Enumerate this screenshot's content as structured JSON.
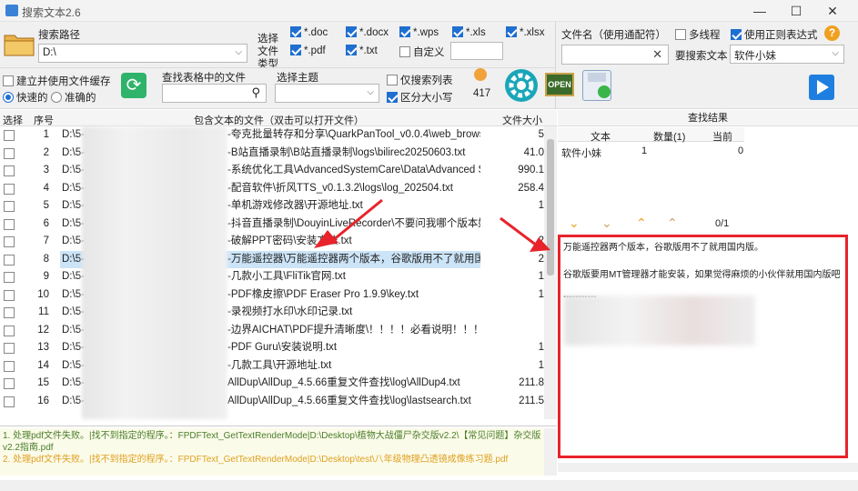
{
  "window": {
    "title": "搜索文本2.6"
  },
  "toolbar": {
    "search_path_label": "搜索路径",
    "search_path_value": "D:\\",
    "filetype_label": "选择文件类型",
    "types": [
      {
        "label": "*.doc",
        "checked": true
      },
      {
        "label": "*.docx",
        "checked": true
      },
      {
        "label": "*.wps",
        "checked": true
      },
      {
        "label": "*.xls",
        "checked": true
      },
      {
        "label": "*.xlsx",
        "checked": true
      },
      {
        "label": "*.pdf",
        "checked": true
      },
      {
        "label": "*.txt",
        "checked": true
      },
      {
        "label": "自定义",
        "checked": false
      }
    ],
    "filename_label": "文件名（使用通配符）",
    "multithread_label": "多线程",
    "multithread_checked": false,
    "regex_label": "使用正则表达式",
    "regex_checked": true,
    "search_text_label": "要搜索文本",
    "search_text_value": "软件小妹",
    "cache_label": "建立并使用文件缓存",
    "fast_label": "快速的",
    "accurate_label": "准确的",
    "table_search_label": "查找表格中的文件",
    "topic_label": "选择主题",
    "only_search_list_label": "仅搜索列表",
    "case_label": "区分大小写",
    "case_checked": true,
    "count_value": "417"
  },
  "grid": {
    "headers": [
      "选择",
      "序号",
      "包含文本的文件（双击可以打开文件）",
      "文件大小"
    ],
    "selected_index": 7,
    "rows": [
      {
        "num": "1",
        "path": "D:\\5-",
        "tail": "-夸克批量转存和分享\\QuarkPanTool_v0.0.4\\web_browse...",
        "size": "5"
      },
      {
        "num": "2",
        "path": "D:\\5-",
        "tail": "-B站直播录制\\B站直播录制\\logs\\bilirec20250603.txt",
        "size": "41.0"
      },
      {
        "num": "3",
        "path": "D:\\5-",
        "tail": "-系统优化工具\\AdvancedSystemCare\\Data\\Advanced Sy...",
        "size": "990.1"
      },
      {
        "num": "4",
        "path": "D:\\5-",
        "tail": "-配音软件\\折风TTS_v0.1.3.2\\logs\\log_202504.txt",
        "size": "258.4"
      },
      {
        "num": "5",
        "path": "D:\\5-",
        "tail": "-单机游戏修改器\\开源地址.txt",
        "size": "1"
      },
      {
        "num": "6",
        "path": "D:\\5-",
        "tail": "-抖音直播录制\\DouyinLiveRecorder\\不要问我哪个版本好...",
        "size": ""
      },
      {
        "num": "7",
        "path": "D:\\5-",
        "tail": "-破解PPT密码\\安装方法.txt",
        "size": "2"
      },
      {
        "num": "8",
        "path": "D:\\5-",
        "tail": "-万能遥控器\\万能遥控器两个版本，谷歌版用不了就用国内...",
        "size": "2"
      },
      {
        "num": "9",
        "path": "D:\\5-",
        "tail": "-几款小工具\\FliTik官网.txt",
        "size": "1"
      },
      {
        "num": "10",
        "path": "D:\\5-",
        "tail": "-PDF橡皮擦\\PDF Eraser Pro 1.9.9\\key.txt",
        "size": "1"
      },
      {
        "num": "11",
        "path": "D:\\5-",
        "tail": "-录视频打水印\\水印记录.txt",
        "size": ""
      },
      {
        "num": "12",
        "path": "D:\\5-",
        "tail": "-边界AICHAT\\PDF提升清晰度\\！！！！必看说明！！！！.t...",
        "size": ""
      },
      {
        "num": "13",
        "path": "D:\\5-",
        "tail": "-PDF Guru\\安装说明.txt",
        "size": "1"
      },
      {
        "num": "14",
        "path": "D:\\5-",
        "tail": "-几款工具\\开源地址.txt",
        "size": "1"
      },
      {
        "num": "15",
        "path": "D:\\5-",
        "tail": "AllDup\\AllDup_4.5.66重复文件查找\\log\\AllDup4.txt",
        "size": "211.8"
      },
      {
        "num": "16",
        "path": "D:\\5-",
        "tail": "AllDup\\AllDup_4.5.66重复文件查找\\log\\lastsearch.txt",
        "size": "211.5"
      }
    ]
  },
  "results": {
    "title": "查找结果",
    "headers": [
      "文本",
      "数量(1)",
      "当前"
    ],
    "row": {
      "text": "软件小妹",
      "count": "1",
      "current": "0"
    },
    "nav_counter": "0/1",
    "preview_line1": "万能遥控器两个版本，谷歌版用不了就用国内版。",
    "preview_line2": "谷歌版要用MT管理器才能安装，如果觉得麻烦的小伙伴就用国内版吧",
    "preview_dashes": "-----------"
  },
  "log": {
    "line1": "1. 处理pdf文件失败。|找不到指定的程序。：FPDFText_GetTextRenderMode|D:\\Desktop\\植物大战僵尸杂交版v2.2\\【常见问题】杂交版v2.2指南.pdf",
    "line2": "2. 处理pdf文件失败。|找不到指定的程序。：FPDFText_GetTextRenderMode|D:\\Desktop\\test\\八年级物理凸透镜成像练习题.pdf"
  },
  "colors": {
    "accent": "#1f6fd0",
    "highlight_red": "#e8232b",
    "log_bg": "#fbfbe9",
    "selected_row": "#cce4f7"
  }
}
